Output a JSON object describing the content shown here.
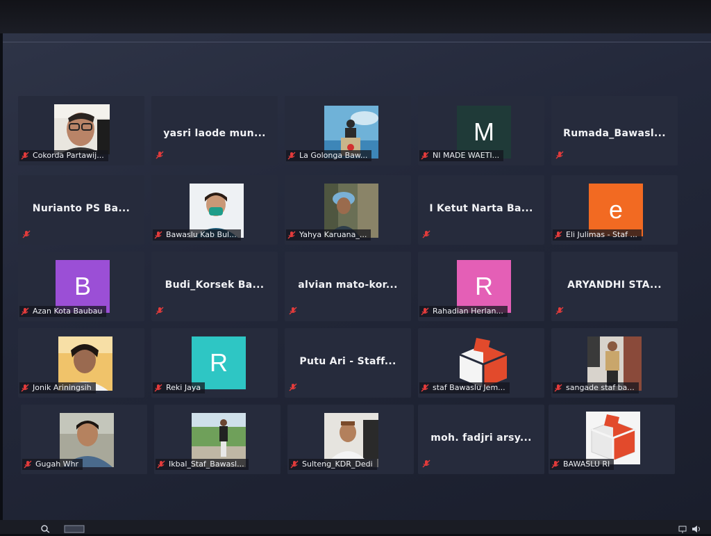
{
  "participants": [
    {
      "display_name": "Cokorda Partawij...",
      "tile": "photo",
      "icon": "person-glasses-photo"
    },
    {
      "display_name": "yasri laode mun...",
      "tile": "name"
    },
    {
      "display_name": "La Golonga Baw...",
      "tile": "photo",
      "icon": "speaker-podium-photo"
    },
    {
      "display_name": "NI MADE WAETI...",
      "tile": "letter",
      "letter": "M",
      "color": "#1f3a38"
    },
    {
      "display_name": "Rumada_Bawasl...",
      "tile": "name"
    },
    {
      "display_name": "Nurianto PS Ba...",
      "tile": "name"
    },
    {
      "display_name": "Bawaslu Kab Bul...",
      "tile": "photo",
      "icon": "woman-mask-photo"
    },
    {
      "display_name": "Yahya Karuana_...",
      "tile": "photo",
      "icon": "person-hat-photo"
    },
    {
      "display_name": "I Ketut Narta Ba...",
      "tile": "name"
    },
    {
      "display_name": "Eli Julimas - Staf ...",
      "tile": "letter",
      "letter": "e",
      "color": "#f26a22"
    },
    {
      "display_name": "Azan Kota Baubau",
      "tile": "letter",
      "letter": "B",
      "color": "#9b4fd6"
    },
    {
      "display_name": "Budi_Korsek Ba...",
      "tile": "name"
    },
    {
      "display_name": "alvian mato-kor...",
      "tile": "name"
    },
    {
      "display_name": "Rahadian Herlan...",
      "tile": "letter",
      "letter": "R",
      "color": "#e45fb6"
    },
    {
      "display_name": "ARYANDHI STA...",
      "tile": "name"
    },
    {
      "display_name": "Jonik Ariningsih",
      "tile": "photo",
      "icon": "woman-photo"
    },
    {
      "display_name": "Reki Jaya",
      "tile": "letter",
      "letter": "R",
      "color": "#2ec6c4"
    },
    {
      "display_name": "Putu Ari - Staff...",
      "tile": "name"
    },
    {
      "display_name": "staf Bawaslu Jem...",
      "tile": "photo",
      "icon": "bawaslu-logo"
    },
    {
      "display_name": "sangade staf ba...",
      "tile": "photo",
      "icon": "person-standing-photo"
    },
    {
      "display_name": "Gugah Whr",
      "tile": "photo",
      "icon": "man-portrait-photo"
    },
    {
      "display_name": "Ikbal_Staf_Bawasl...",
      "tile": "photo",
      "icon": "outdoor-person-photo"
    },
    {
      "display_name": "Sulteng_KDR_Dedi",
      "tile": "photo",
      "icon": "man-desk-photo"
    },
    {
      "display_name": "moh. fadjri arsy...",
      "tile": "name"
    },
    {
      "display_name": "BAWASLU RI",
      "tile": "photo",
      "icon": "bawaslu-logo"
    }
  ],
  "icons": {
    "mute": "microphone-muted-icon"
  },
  "colors": {
    "mute_red": "#e23b3b",
    "tile_bg": "#262b3c",
    "screen_bg": "#23283a"
  }
}
